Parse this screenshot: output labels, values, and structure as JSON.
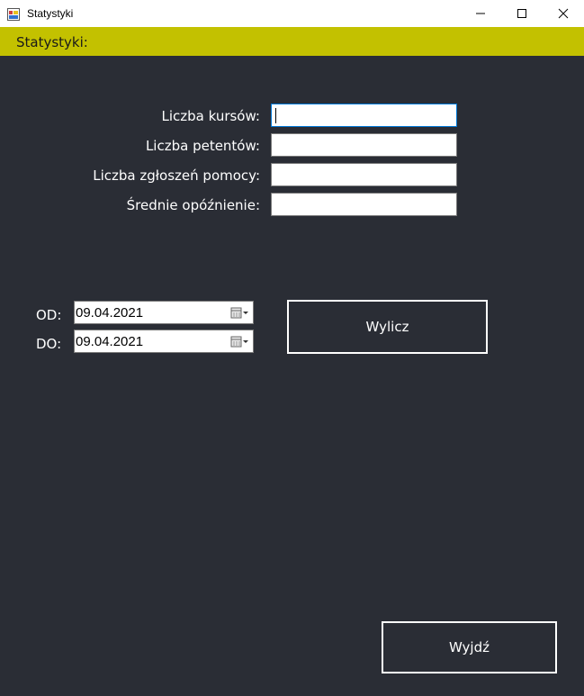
{
  "window": {
    "title": "Statystyki",
    "icon": "app-form-icon",
    "controls": [
      "minimize-icon",
      "maximize-icon",
      "close-icon"
    ]
  },
  "header": {
    "label": "Statystyki:",
    "color": "#c3c100"
  },
  "stats": {
    "courses_label": "Liczba kursów:",
    "courses_value": "",
    "applicants_label": "Liczba petentów:",
    "applicants_value": "",
    "help_requests_label": "Liczba zgłoszeń pomocy:",
    "help_requests_value": "",
    "avg_delay_label": "Średnie opóźnienie:",
    "avg_delay_value": ""
  },
  "date_range": {
    "from_label": "OD:",
    "from_value": "09.04.2021",
    "to_label": "DO:",
    "to_value": "09.04.2021"
  },
  "buttons": {
    "calculate": "Wylicz",
    "exit": "Wyjdź"
  },
  "colors": {
    "background": "#2a2d35",
    "accent": "#c3c100",
    "focus": "#0078d7"
  }
}
